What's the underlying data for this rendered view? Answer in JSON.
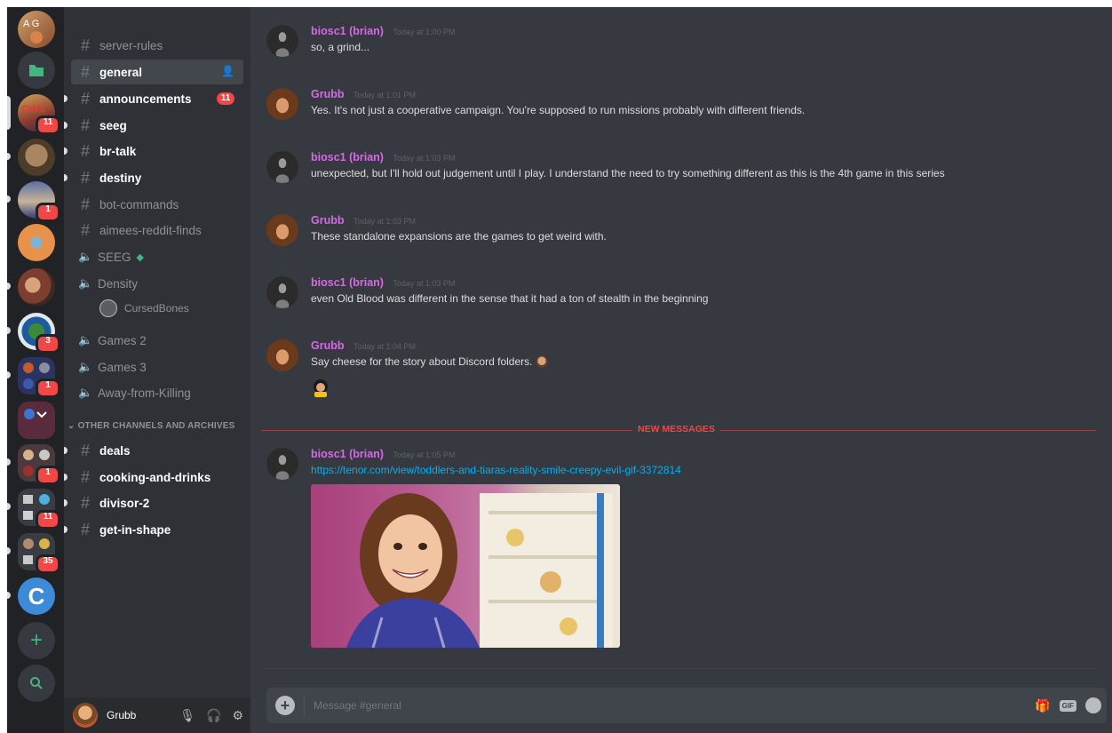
{
  "colors": {
    "rail": "#202225",
    "sidebar": "#2f3136",
    "chat": "#36393f",
    "username": "#d569e6",
    "mention_red": "#f04747",
    "link": "#00b0f4"
  },
  "rail": {
    "servers": [
      {
        "name": "server-1-icon",
        "badge": ""
      },
      {
        "name": "home-folder-icon",
        "badge": ""
      },
      {
        "name": "server-chair-icon",
        "badge": "11"
      },
      {
        "name": "server-dog-icon",
        "badge": ""
      },
      {
        "name": "server-meme-icon",
        "badge": "1"
      },
      {
        "name": "server-orange-icon",
        "badge": ""
      },
      {
        "name": "server-group-photo-icon",
        "badge": ""
      },
      {
        "name": "server-globe-icon",
        "badge": "3"
      },
      {
        "name": "server-folder-a-icon",
        "badge": "1"
      },
      {
        "name": "server-folder-b-icon",
        "badge": ""
      },
      {
        "name": "server-folder-c-icon",
        "badge": "1"
      },
      {
        "name": "server-folder-d-icon",
        "badge": "11"
      },
      {
        "name": "server-folder-e-icon",
        "badge": "35"
      },
      {
        "name": "server-c-icon",
        "badge": "",
        "letter": "C"
      }
    ],
    "add_label": "+",
    "search_glyph": "⌕"
  },
  "sidebar": {
    "channels": [
      {
        "label": "server-rules",
        "type": "text",
        "state": "read"
      },
      {
        "label": "general",
        "type": "text",
        "state": "selected"
      },
      {
        "label": "announcements",
        "type": "text",
        "state": "unread",
        "badge": "11"
      },
      {
        "label": "seeg",
        "type": "text",
        "state": "unread"
      },
      {
        "label": "br-talk",
        "type": "text",
        "state": "unread"
      },
      {
        "label": "destiny",
        "type": "text",
        "state": "unread"
      },
      {
        "label": "bot-commands",
        "type": "text",
        "state": "read"
      },
      {
        "label": "aimees-reddit-finds",
        "type": "text",
        "state": "read"
      },
      {
        "label": "SEEG",
        "type": "voice",
        "state": "read"
      },
      {
        "label": "Density",
        "type": "voice",
        "state": "read"
      },
      {
        "label": "Games 2",
        "type": "voice",
        "state": "read"
      },
      {
        "label": "Games 3",
        "type": "voice",
        "state": "read"
      },
      {
        "label": "Away-from-Killing",
        "type": "voice",
        "state": "read"
      }
    ],
    "voice_user": "CursedBones",
    "category": "OTHER CHANNELS AND ARCHIVES",
    "archive_channels": [
      {
        "label": "deals"
      },
      {
        "label": "cooking-and-drinks"
      },
      {
        "label": "divisor-2"
      },
      {
        "label": "get-in-shape"
      }
    ],
    "user": {
      "name": "Grubb"
    }
  },
  "chat": {
    "messages": [
      {
        "author": "biosc1 (brian)",
        "time": "Today at 1:00 PM",
        "text": "so, a grind..."
      },
      {
        "author": "Grubb",
        "time": "Today at 1:01 PM",
        "text": "Yes. It's not just a cooperative campaign. You're supposed to run missions probably with different friends."
      },
      {
        "author": "biosc1 (brian)",
        "time": "Today at 1:03 PM",
        "text": "unexpected, but I'll hold out judgement until I play.  I understand the need to try something different as this is the 4th game in this series"
      },
      {
        "author": "Grubb",
        "time": "Today at 1:03 PM",
        "text": "These standalone expansions are the games to get weird with."
      },
      {
        "author": "biosc1 (brian)",
        "time": "Today at 1:03 PM",
        "text": "even Old Blood was different in the sense that it had a ton of stealth in the beginning"
      },
      {
        "author": "Grubb",
        "time": "Today at 1:04 PM",
        "text": "Say cheese for the story about Discord folders."
      },
      {
        "author": "biosc1 (brian)",
        "time": "Today at 1:05 PM",
        "text": "https://tenor.com/view/toddlers-and-tiaras-reality-smile-creepy-evil-gif-3372814"
      }
    ],
    "new_messages_label": "NEW MESSAGES",
    "composer_placeholder": "Message #general",
    "gif_label": "GIF"
  }
}
